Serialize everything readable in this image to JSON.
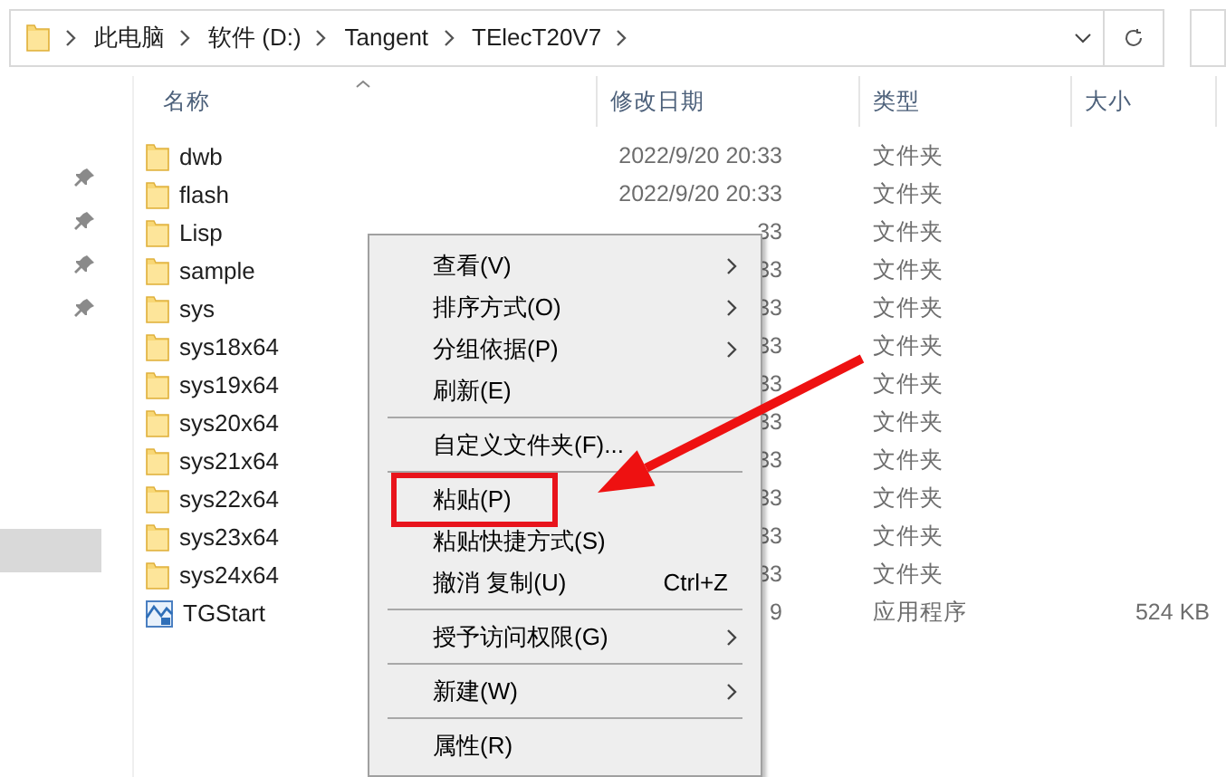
{
  "address_bar": {
    "segments": [
      "此电脑",
      "软件 (D:)",
      "Tangent",
      "TElecT20V7"
    ]
  },
  "nav_pane": {
    "items": [
      {
        "pinned": true,
        "selected": false
      },
      {
        "pinned": true,
        "selected": false
      },
      {
        "pinned": true,
        "selected": false
      },
      {
        "pinned": true,
        "selected": false
      },
      {
        "pinned": false,
        "selected": true
      }
    ]
  },
  "table": {
    "columns": [
      "名称",
      "修改日期",
      "类型",
      "大小"
    ],
    "rows": [
      {
        "kind": "folder",
        "name": "dwb",
        "date": "2022/9/20 20:33",
        "type": "文件夹",
        "size": ""
      },
      {
        "kind": "folder",
        "name": "flash",
        "date": "2022/9/20 20:33",
        "type": "文件夹"
      },
      {
        "kind": "folder",
        "name": "Lisp",
        "date": "33",
        "type": "文件夹"
      },
      {
        "kind": "folder",
        "name": "sample",
        "date": "33",
        "type": "文件夹"
      },
      {
        "kind": "folder",
        "name": "sys",
        "date": "33",
        "type": "文件夹"
      },
      {
        "kind": "folder",
        "name": "sys18x64",
        "date": "33",
        "type": "文件夹"
      },
      {
        "kind": "folder",
        "name": "sys19x64",
        "date": "33",
        "type": "文件夹"
      },
      {
        "kind": "folder",
        "name": "sys20x64",
        "date": "33",
        "type": "文件夹"
      },
      {
        "kind": "folder",
        "name": "sys21x64",
        "date": "33",
        "type": "文件夹"
      },
      {
        "kind": "folder",
        "name": "sys22x64",
        "date": "33",
        "type": "文件夹"
      },
      {
        "kind": "folder",
        "name": "sys23x64",
        "date": "33",
        "type": "文件夹"
      },
      {
        "kind": "folder",
        "name": "sys24x64",
        "date": "33",
        "type": "文件夹"
      },
      {
        "kind": "app",
        "name": "TGStart",
        "date": "9",
        "type": "应用程序",
        "size": "524 KB"
      }
    ]
  },
  "context_menu": {
    "items": [
      {
        "kind": "item",
        "label": "查看(V)",
        "submenu": true,
        "marked": false
      },
      {
        "kind": "item",
        "label": "排序方式(O)",
        "submenu": true,
        "marked": false
      },
      {
        "kind": "item",
        "label": "分组依据(P)",
        "submenu": true,
        "marked": false
      },
      {
        "kind": "item",
        "label": "刷新(E)",
        "submenu": false,
        "marked": false
      },
      {
        "kind": "separator"
      },
      {
        "kind": "item",
        "label": "自定义文件夹(F)...",
        "submenu": false,
        "marked": false
      },
      {
        "kind": "separator"
      },
      {
        "kind": "item",
        "label": "粘贴(P)",
        "submenu": false,
        "marked": true
      },
      {
        "kind": "item",
        "label": "粘贴快捷方式(S)",
        "submenu": false,
        "marked": false
      },
      {
        "kind": "item",
        "label": "撤消 复制(U)",
        "shortcut": "Ctrl+Z",
        "submenu": false,
        "marked": false
      },
      {
        "kind": "separator"
      },
      {
        "kind": "item",
        "label": "授予访问权限(G)",
        "submenu": true,
        "marked": false
      },
      {
        "kind": "separator"
      },
      {
        "kind": "item",
        "label": "新建(W)",
        "submenu": true,
        "marked": false
      },
      {
        "kind": "separator"
      },
      {
        "kind": "item",
        "label": "属性(R)",
        "submenu": false,
        "marked": false
      }
    ]
  }
}
